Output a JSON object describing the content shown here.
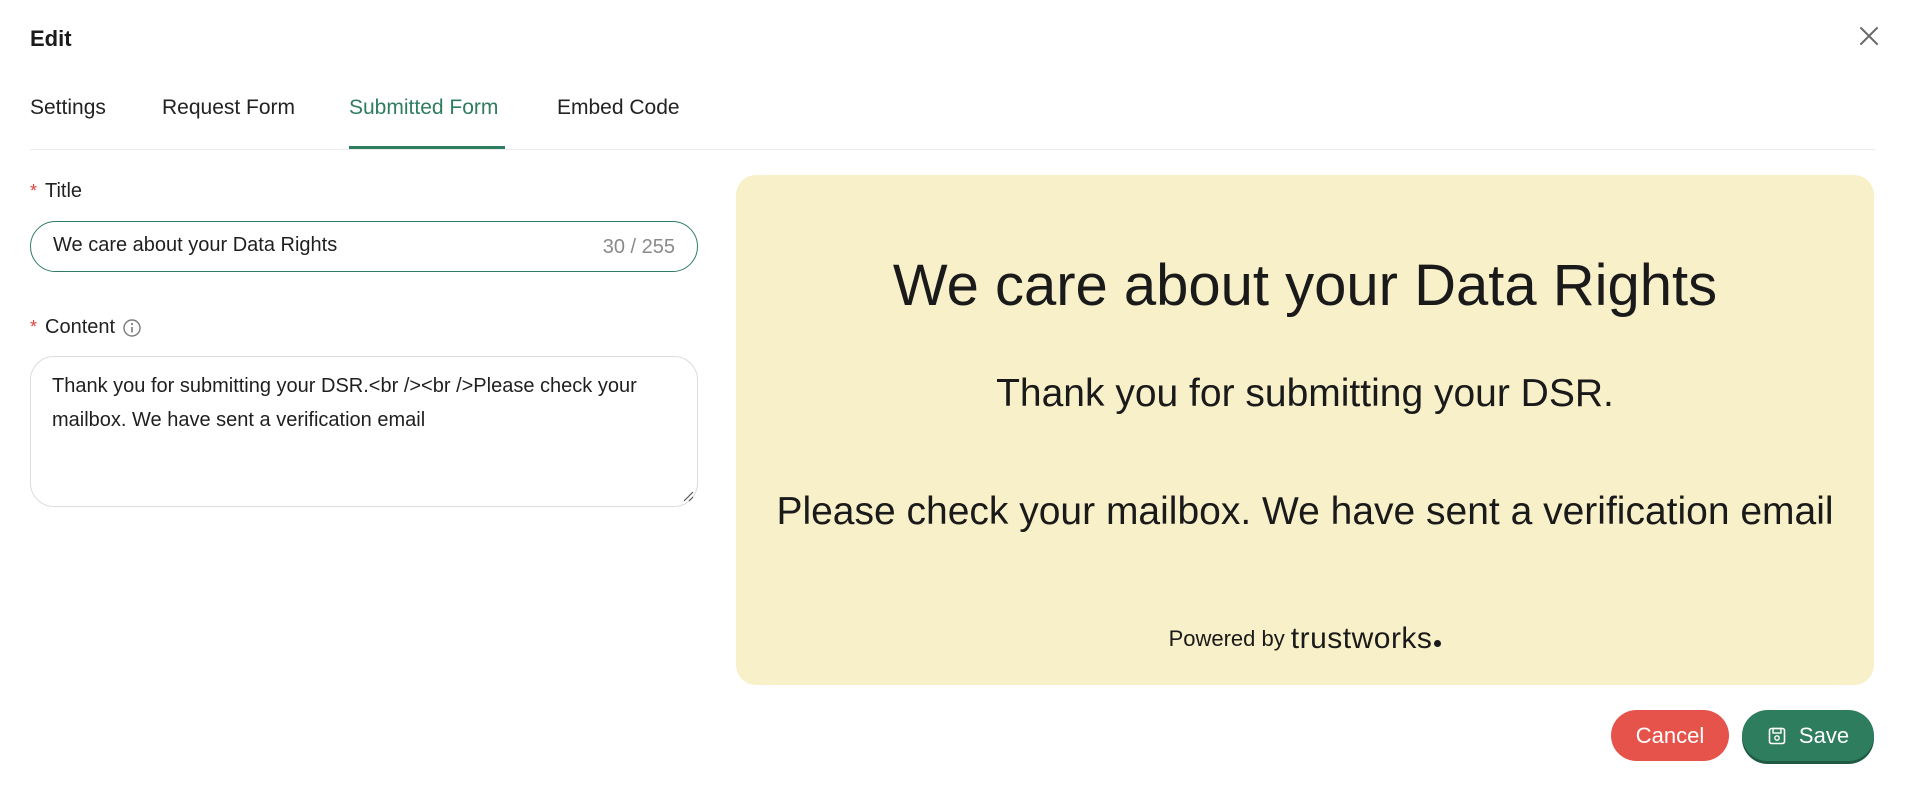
{
  "modal": {
    "title": "Edit",
    "close_icon": "close-icon"
  },
  "tabs": [
    {
      "label": "Settings",
      "active": false
    },
    {
      "label": "Request Form",
      "active": false
    },
    {
      "label": "Submitted Form",
      "active": true
    },
    {
      "label": "Embed Code",
      "active": false
    }
  ],
  "form": {
    "title": {
      "label": "Title",
      "required": "*",
      "value": "We care about your Data Rights",
      "counter": "30 / 255"
    },
    "content": {
      "label": "Content",
      "required": "*",
      "info_icon": "info-icon",
      "value": "Thank you for submitting your DSR.<br /><br />Please check your mailbox. We have sent a verification email"
    }
  },
  "preview": {
    "title": "We care about your Data Rights",
    "line1": "Thank you for submitting your DSR.",
    "line2": "Please check your mailbox. We have sent a verification email",
    "powered_by": "Powered by",
    "brand": "trustworks",
    "background": "#f8f0c9"
  },
  "actions": {
    "cancel_label": "Cancel",
    "save_label": "Save",
    "save_icon": "save-icon"
  },
  "colors": {
    "accent": "#2f7d5f",
    "danger": "#e5534b",
    "required": "#e0403c"
  }
}
